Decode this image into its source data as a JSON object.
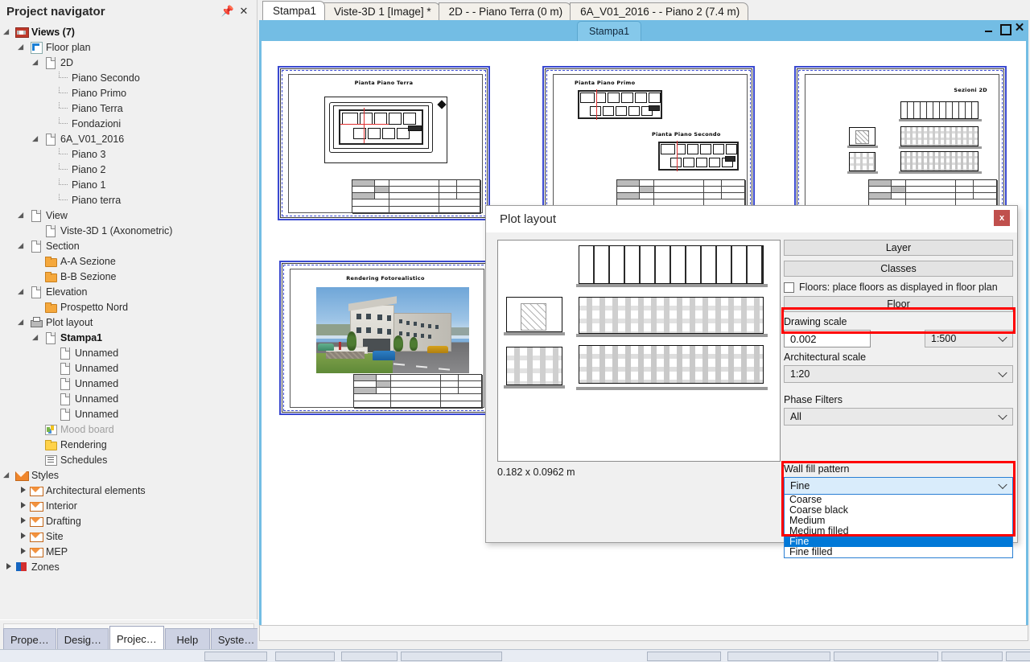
{
  "sidebar": {
    "title": "Project navigator",
    "pin_icon": "pin-icon",
    "close_icon": "close-icon",
    "tree": [
      {
        "label": "Views (7)",
        "depth": 0,
        "icon": "views-icon",
        "arrow": "down",
        "bold": true
      },
      {
        "label": "Floor plan",
        "depth": 1,
        "icon": "floorplan-icon",
        "arrow": "down"
      },
      {
        "label": "2D",
        "depth": 2,
        "icon": "doc-icon",
        "arrow": "down"
      },
      {
        "label": "Piano Secondo",
        "depth": 3,
        "icon": "leaf",
        "arrow": "none"
      },
      {
        "label": "Piano Primo",
        "depth": 3,
        "icon": "leaf",
        "arrow": "none"
      },
      {
        "label": "Piano Terra",
        "depth": 3,
        "icon": "leaf",
        "arrow": "none"
      },
      {
        "label": "Fondazioni",
        "depth": 3,
        "icon": "leaf",
        "arrow": "none"
      },
      {
        "label": "6A_V01_2016",
        "depth": 2,
        "icon": "doc-icon",
        "arrow": "down"
      },
      {
        "label": "Piano 3",
        "depth": 3,
        "icon": "leaf",
        "arrow": "none"
      },
      {
        "label": "Piano 2",
        "depth": 3,
        "icon": "leaf",
        "arrow": "none"
      },
      {
        "label": "Piano 1",
        "depth": 3,
        "icon": "leaf",
        "arrow": "none"
      },
      {
        "label": "Piano terra",
        "depth": 3,
        "icon": "leaf",
        "arrow": "none"
      },
      {
        "label": "View",
        "depth": 1,
        "icon": "doc-icon",
        "arrow": "down"
      },
      {
        "label": "Viste-3D 1 (Axonometric)",
        "depth": 2,
        "icon": "doc-icon",
        "arrow": "none"
      },
      {
        "label": "Section",
        "depth": 1,
        "icon": "doc-icon",
        "arrow": "down"
      },
      {
        "label": "A-A Sezione",
        "depth": 2,
        "icon": "folder-icon",
        "arrow": "none"
      },
      {
        "label": "B-B Sezione",
        "depth": 2,
        "icon": "folder-icon",
        "arrow": "none"
      },
      {
        "label": "Elevation",
        "depth": 1,
        "icon": "doc-icon",
        "arrow": "down"
      },
      {
        "label": "Prospetto Nord",
        "depth": 2,
        "icon": "folder-icon",
        "arrow": "none"
      },
      {
        "label": "Plot layout",
        "depth": 1,
        "icon": "printer-icon",
        "arrow": "down"
      },
      {
        "label": "Stampa1",
        "depth": 2,
        "icon": "doc-icon",
        "arrow": "down",
        "bold": true
      },
      {
        "label": "Unnamed",
        "depth": 3,
        "icon": "doc-icon",
        "arrow": "none"
      },
      {
        "label": "Unnamed",
        "depth": 3,
        "icon": "doc-icon",
        "arrow": "none"
      },
      {
        "label": "Unnamed",
        "depth": 3,
        "icon": "doc-icon",
        "arrow": "none"
      },
      {
        "label": "Unnamed",
        "depth": 3,
        "icon": "doc-icon",
        "arrow": "none"
      },
      {
        "label": "Unnamed",
        "depth": 3,
        "icon": "doc-icon",
        "arrow": "none"
      },
      {
        "label": "Mood board",
        "depth": 2,
        "icon": "moodboard-icon",
        "arrow": "none",
        "dim": true
      },
      {
        "label": "Rendering",
        "depth": 2,
        "icon": "folder-yellow-icon",
        "arrow": "none"
      },
      {
        "label": "Schedules",
        "depth": 2,
        "icon": "schedules-icon",
        "arrow": "none"
      },
      {
        "label": "Styles",
        "depth": 0,
        "icon": "styles-icon",
        "arrow": "down"
      },
      {
        "label": "Architectural elements",
        "depth": 1,
        "icon": "styles-light-icon",
        "arrow": "right"
      },
      {
        "label": "Interior",
        "depth": 1,
        "icon": "styles-light-icon",
        "arrow": "right"
      },
      {
        "label": "Drafting",
        "depth": 1,
        "icon": "styles-light-icon",
        "arrow": "right"
      },
      {
        "label": "Site",
        "depth": 1,
        "icon": "styles-light-icon",
        "arrow": "right"
      },
      {
        "label": "MEP",
        "depth": 1,
        "icon": "styles-light-icon",
        "arrow": "right"
      },
      {
        "label": "Zones",
        "depth": 0,
        "icon": "zones-icon",
        "arrow": "right"
      }
    ],
    "bottom_tabs": [
      {
        "label": "Prope…",
        "active": false
      },
      {
        "label": "Desig…",
        "active": false
      },
      {
        "label": "Projec…",
        "active": true
      },
      {
        "label": "Help",
        "active": false
      },
      {
        "label": "Syste…",
        "active": false
      }
    ]
  },
  "tabs": [
    {
      "label": "Stampa1",
      "active": true
    },
    {
      "label": "Viste-3D 1 [Image] *",
      "active": false
    },
    {
      "label": "2D -  - Piano Terra (0 m)",
      "active": false
    },
    {
      "label": "6A_V01_2016 -  - Piano 2 (7.4 m)",
      "active": false
    }
  ],
  "document_window": {
    "subtab_label": "Stampa1",
    "minimize_icon": "minimize-icon",
    "maximize_icon": "maximize-icon",
    "close_icon": "close-icon"
  },
  "sheets": [
    {
      "title": "Pianta Piano Terra"
    },
    {
      "title": "Pianta Piano Primo",
      "title2": "Pianta Piano Secondo"
    },
    {
      "title": "Sezioni 2D"
    },
    {
      "title": "Rendering Fotorealistico"
    }
  ],
  "dialog": {
    "title": "Plot layout",
    "close_label": "x",
    "dimensions": "0.182 x 0.0962 m",
    "layer_button": "Layer",
    "classes_button": "Classes",
    "floors_checkbox_label": "Floors: place floors as displayed in floor plan",
    "floors_checked": false,
    "floor_button": "Floor",
    "drawing_scale_label": "Drawing scale",
    "drawing_scale_value": "0.002",
    "drawing_scale_select": "1:500",
    "architectural_scale_label": "Architectural scale",
    "architectural_scale_value": "1:20",
    "phase_filters_label": "Phase Filters",
    "phase_filters_value": "All",
    "wall_fill_label": "Wall fill pattern",
    "wall_fill_value": "Fine",
    "wall_fill_options": [
      {
        "label": "Coarse",
        "selected": false
      },
      {
        "label": "Coarse black",
        "selected": false
      },
      {
        "label": "Medium",
        "selected": false
      },
      {
        "label": "Medium filled",
        "selected": false
      },
      {
        "label": "Fine",
        "selected": true
      },
      {
        "label": "Fine filled",
        "selected": false
      }
    ]
  },
  "colors": {
    "accent_blue": "#73bde4",
    "highlight_red": "#ff0000",
    "selection_blue": "#0078d7",
    "sheet_border_blue": "#3a49d0",
    "close_red": "#c0504d"
  }
}
